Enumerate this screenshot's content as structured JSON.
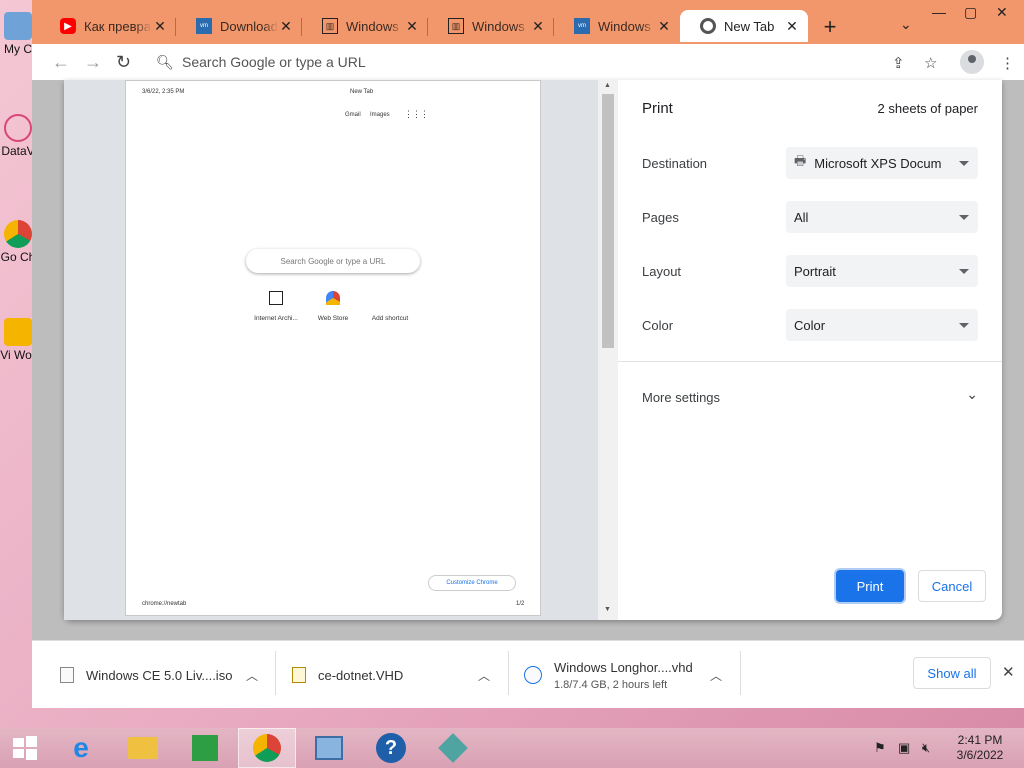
{
  "desktop": {
    "icons": [
      {
        "label": "My C"
      },
      {
        "label": "DataV"
      },
      {
        "label": "Go Ch"
      },
      {
        "label": "Vi Wor"
      }
    ]
  },
  "tabs": [
    {
      "title": "Как превра",
      "icon": "youtube-icon"
    },
    {
      "title": "Download V",
      "icon": "vmware-icon"
    },
    {
      "title": "Windows C",
      "icon": "internet-archive-icon"
    },
    {
      "title": "Windows C",
      "icon": "internet-archive-icon"
    },
    {
      "title": "Windows V",
      "icon": "vmware-icon"
    },
    {
      "title": "New Tab",
      "icon": "chrome-icon",
      "active": true
    }
  ],
  "omnibox": {
    "placeholder": "Search Google or type a URL"
  },
  "preview": {
    "page1": {
      "header_date": "3/6/22, 2:35 PM",
      "header_title": "New Tab",
      "gmail": "Gmail",
      "images": "Images",
      "search_placeholder": "Search Google or type a URL",
      "shortcuts": [
        "Internet Archi...",
        "Web Store",
        "Add shortcut"
      ],
      "customize": "Customize Chrome",
      "footer_url": "chrome://newtab",
      "footer_page": "1/2"
    }
  },
  "print": {
    "title": "Print",
    "sheets": "2 sheets of paper",
    "rows": [
      {
        "label": "Destination",
        "value": "Microsoft XPS Docum"
      },
      {
        "label": "Pages",
        "value": "All"
      },
      {
        "label": "Layout",
        "value": "Portrait"
      },
      {
        "label": "Color",
        "value": "Color"
      }
    ],
    "more_settings": "More settings",
    "print_button": "Print",
    "cancel_button": "Cancel"
  },
  "downloads": [
    {
      "name": "Windows CE 5.0 Liv....iso",
      "sub": ""
    },
    {
      "name": "ce-dotnet.VHD",
      "sub": ""
    },
    {
      "name": "Windows Longhor....vhd",
      "sub": "1.8/7.4 GB, 2 hours left"
    }
  ],
  "shelf": {
    "show_all": "Show all"
  },
  "clock": {
    "time": "2:41 PM",
    "date": "3/6/2022"
  },
  "colors": {
    "tabstrip": "#f2976b",
    "accent": "#1a73e8"
  }
}
